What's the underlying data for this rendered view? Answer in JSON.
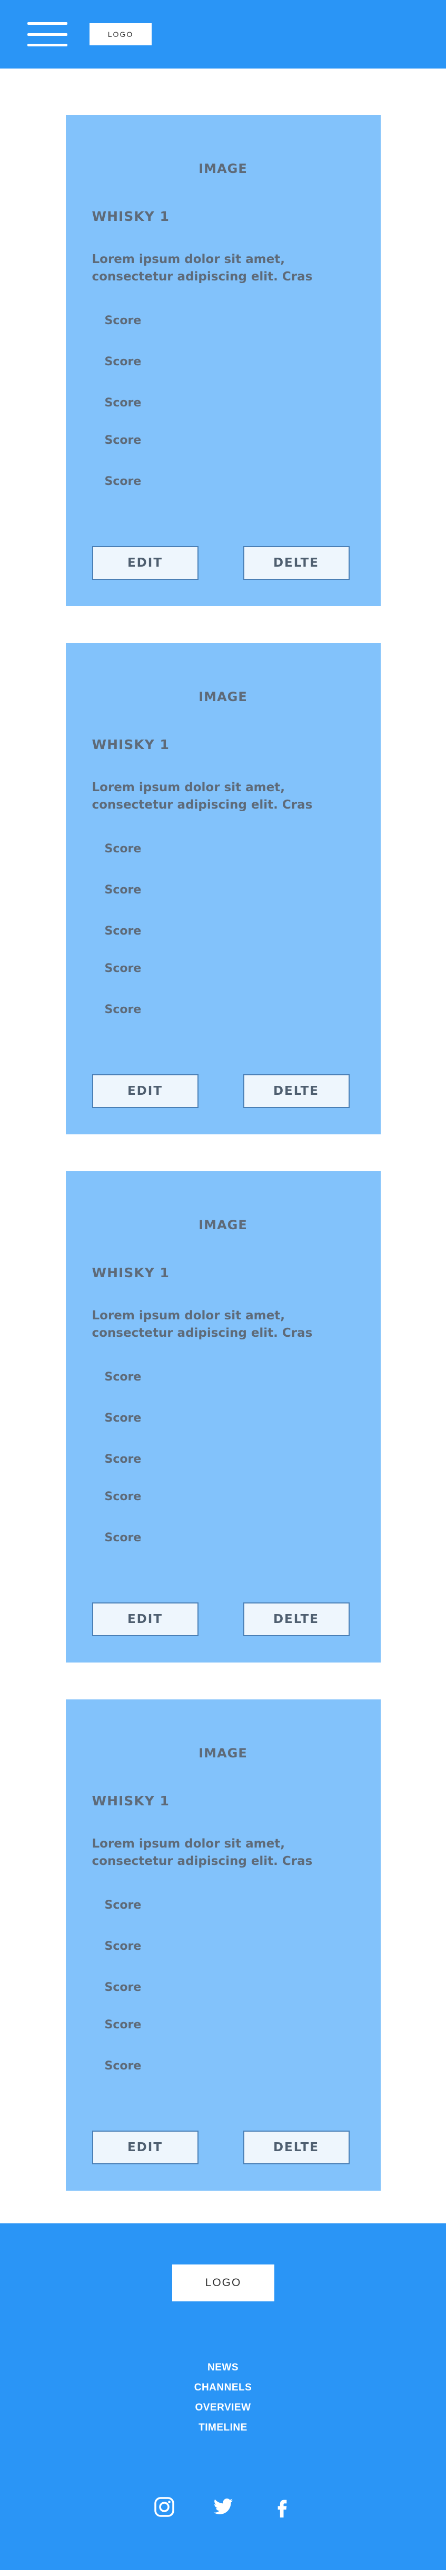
{
  "header": {
    "logo_label": "LOGO"
  },
  "cards": [
    {
      "image_label": "IMAGE",
      "title": "WHISKY 1",
      "description": "Lorem ipsum dolor sit amet, consectetur adipiscing elit. Cras",
      "scores": [
        "Score",
        "Score",
        "Score",
        "Score",
        "Score"
      ],
      "edit_label": "EDIT",
      "delete_label": "DELTE"
    },
    {
      "image_label": "IMAGE",
      "title": "WHISKY 1",
      "description": "Lorem ipsum dolor sit amet, consectetur adipiscing elit. Cras",
      "scores": [
        "Score",
        "Score",
        "Score",
        "Score",
        "Score"
      ],
      "edit_label": "EDIT",
      "delete_label": "DELTE"
    },
    {
      "image_label": "IMAGE",
      "title": "WHISKY 1",
      "description": "Lorem ipsum dolor sit amet, consectetur adipiscing elit. Cras",
      "scores": [
        "Score",
        "Score",
        "Score",
        "Score",
        "Score"
      ],
      "edit_label": "EDIT",
      "delete_label": "DELTE"
    },
    {
      "image_label": "IMAGE",
      "title": "WHISKY 1",
      "description": "Lorem ipsum dolor sit amet, consectetur adipiscing elit. Cras",
      "scores": [
        "Score",
        "Score",
        "Score",
        "Score",
        "Score"
      ],
      "edit_label": "EDIT",
      "delete_label": "DELTE"
    }
  ],
  "footer": {
    "logo_label": "LOGO",
    "nav": [
      "NEWS",
      "CHANNELS",
      "OVERVIEW",
      "TIMELINE"
    ],
    "social_icons": [
      "instagram-icon",
      "twitter-icon",
      "facebook-icon"
    ]
  },
  "colors": {
    "brand_blue": "#2a95f6",
    "card_blue": "#82c2fb",
    "button_bg": "#eef6fd",
    "text_gray": "#5e6a78"
  }
}
